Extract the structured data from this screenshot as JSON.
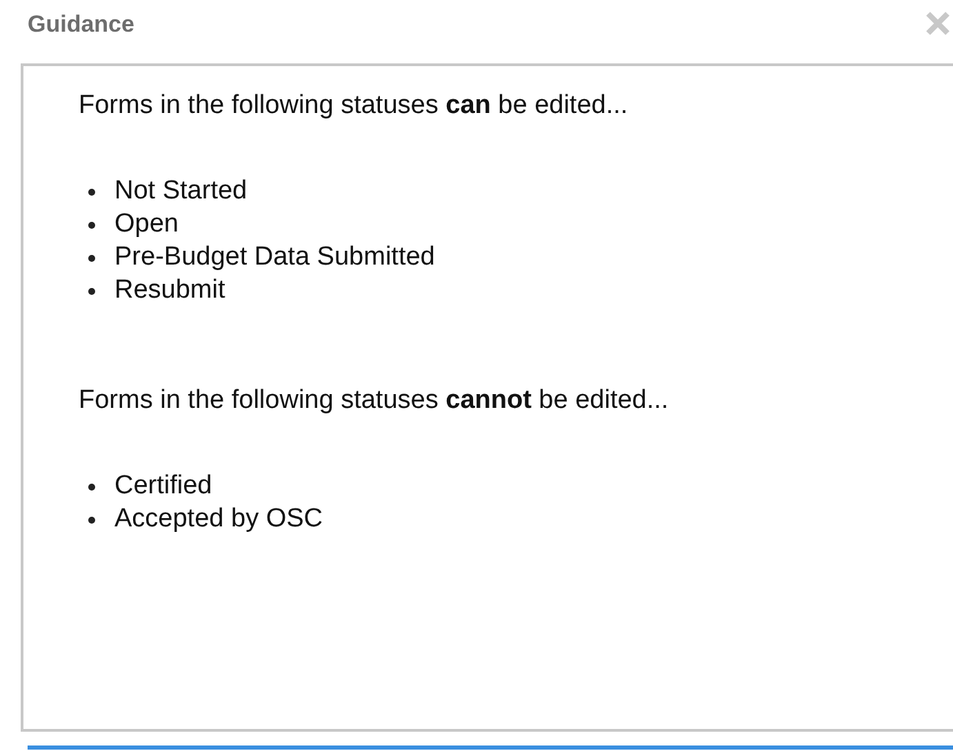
{
  "dialog": {
    "title": "Guidance"
  },
  "sections": [
    {
      "text": "Forms in the following statuses **can** be edited...",
      "items": [
        "Not Started",
        "Open",
        "Pre-Budget Data Submitted",
        "Resubmit"
      ]
    },
    {
      "text": "Forms in the following statuses **cannot** be edited...",
      "items": [
        "Certified",
        "Accepted by OSC"
      ]
    }
  ]
}
